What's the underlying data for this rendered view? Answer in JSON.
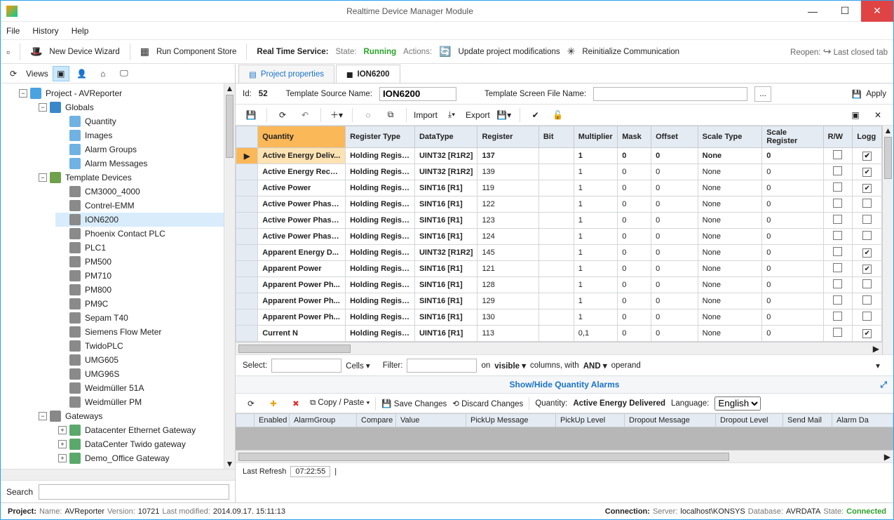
{
  "window": {
    "title": "Realtime Device Manager Module"
  },
  "menu": {
    "file": "File",
    "history": "History",
    "help": "Help"
  },
  "toolbar": {
    "newDevice": "New Device Wizard",
    "runStore": "Run Component Store",
    "rtsLabel": "Real Time Service:",
    "stateLabel": "State:",
    "stateValue": "Running",
    "actionsLabel": "Actions:",
    "updateMods": "Update project modifications",
    "reinit": "Reinitialize Communication",
    "reopenLabel": "Reopen:",
    "lastClosed": "Last closed tab"
  },
  "side": {
    "viewsLabel": "Views",
    "searchLabel": "Search"
  },
  "tree": {
    "root": "Project - AVReporter",
    "globals": "Globals",
    "globalsChildren": [
      "Quantity",
      "Images",
      "Alarm Groups",
      "Alarm Messages"
    ],
    "templates": "Template Devices",
    "templateDevices": [
      "CM3000_4000",
      "Contrel-EMM",
      "ION6200",
      "Phoenix Contact PLC",
      "PLC1",
      "PM500",
      "PM710",
      "PM800",
      "PM9C",
      "Sepam T40",
      "Siemens Flow Meter",
      "TwidoPLC",
      "UMG605",
      "UMG96S",
      "Weidmüller 51A",
      "Weidmüller PM"
    ],
    "gateways": "Gateways",
    "gatewayChildren": [
      "Datacenter Ethernet Gateway",
      "DataCenter Twido gateway",
      "Demo_Office Gateway"
    ]
  },
  "tabs": {
    "projectProps": "Project properties",
    "device": "ION6200"
  },
  "props": {
    "idLabel": "Id:",
    "idValue": "52",
    "tplLabel": "Template Source Name:",
    "tplValue": "ION6200",
    "screenLabel": "Template Screen File Name:",
    "screenValue": "",
    "ellipsis": "...",
    "apply": "Apply"
  },
  "gridToolbar": {
    "import": "Import",
    "export": "Export"
  },
  "columns": {
    "quantity": "Quantity",
    "registerType": "Register Type",
    "dataType": "DataType",
    "register": "Register",
    "bit": "Bit",
    "multiplier": "Multiplier",
    "mask": "Mask",
    "offset": "Offset",
    "scaleType": "Scale Type",
    "scaleRegister": "Scale Register",
    "rw": "R/W",
    "logg": "Logg"
  },
  "rows": [
    {
      "q": "Active Energy Deliv...",
      "rt": "Holding Registers",
      "dt": "UINT32 [R1R2]",
      "rg": "137",
      "bit": "",
      "mul": "1",
      "msk": "0",
      "off": "0",
      "st": "None",
      "sr": "0",
      "rw": false,
      "log": true,
      "sel": true
    },
    {
      "q": "Active Energy Recei...",
      "rt": "Holding Registers",
      "dt": "UINT32 [R1R2]",
      "rg": "139",
      "bit": "",
      "mul": "1",
      "msk": "0",
      "off": "0",
      "st": "None",
      "sr": "0",
      "rw": false,
      "log": true
    },
    {
      "q": "Active Power",
      "rt": "Holding Registers",
      "dt": "SINT16 [R1]",
      "rg": "119",
      "bit": "",
      "mul": "1",
      "msk": "0",
      "off": "0",
      "st": "None",
      "sr": "0",
      "rw": false,
      "log": true
    },
    {
      "q": "Active Power Phase A",
      "rt": "Holding Registers",
      "dt": "SINT16 [R1]",
      "rg": "122",
      "bit": "",
      "mul": "1",
      "msk": "0",
      "off": "0",
      "st": "None",
      "sr": "0",
      "rw": false,
      "log": false
    },
    {
      "q": "Active Power Phase B",
      "rt": "Holding Registers",
      "dt": "SINT16 [R1]",
      "rg": "123",
      "bit": "",
      "mul": "1",
      "msk": "0",
      "off": "0",
      "st": "None",
      "sr": "0",
      "rw": false,
      "log": false
    },
    {
      "q": "Active Power Phase C",
      "rt": "Holding Registers",
      "dt": "SINT16 [R1]",
      "rg": "124",
      "bit": "",
      "mul": "1",
      "msk": "0",
      "off": "0",
      "st": "None",
      "sr": "0",
      "rw": false,
      "log": false
    },
    {
      "q": "Apparent Energy D...",
      "rt": "Holding Registers",
      "dt": "UINT32 [R1R2]",
      "rg": "145",
      "bit": "",
      "mul": "1",
      "msk": "0",
      "off": "0",
      "st": "None",
      "sr": "0",
      "rw": false,
      "log": true
    },
    {
      "q": "Apparent Power",
      "rt": "Holding Registers",
      "dt": "SINT16 [R1]",
      "rg": "121",
      "bit": "",
      "mul": "1",
      "msk": "0",
      "off": "0",
      "st": "None",
      "sr": "0",
      "rw": false,
      "log": true
    },
    {
      "q": "Apparent Power Ph...",
      "rt": "Holding Registers",
      "dt": "SINT16 [R1]",
      "rg": "128",
      "bit": "",
      "mul": "1",
      "msk": "0",
      "off": "0",
      "st": "None",
      "sr": "0",
      "rw": false,
      "log": false
    },
    {
      "q": "Apparent Power Ph...",
      "rt": "Holding Registers",
      "dt": "SINT16 [R1]",
      "rg": "129",
      "bit": "",
      "mul": "1",
      "msk": "0",
      "off": "0",
      "st": "None",
      "sr": "0",
      "rw": false,
      "log": false
    },
    {
      "q": "Apparent Power Ph...",
      "rt": "Holding Registers",
      "dt": "SINT16 [R1]",
      "rg": "130",
      "bit": "",
      "mul": "1",
      "msk": "0",
      "off": "0",
      "st": "None",
      "sr": "0",
      "rw": false,
      "log": false
    },
    {
      "q": "Current N",
      "rt": "Holding Registers",
      "dt": "UINT16 [R1]",
      "rg": "113",
      "bit": "",
      "mul": "0,1",
      "msk": "0",
      "off": "0",
      "st": "None",
      "sr": "0",
      "rw": false,
      "log": true
    }
  ],
  "filter": {
    "select": "Select:",
    "cells": "Cells",
    "filterLabel": "Filter:",
    "on": "on",
    "visible": "visible",
    "colsWith": "columns, with",
    "and": "AND",
    "operand": "operand"
  },
  "alarms": {
    "header": "Show/Hide Quantity Alarms",
    "copyPaste": "Copy / Paste",
    "save": "Save Changes",
    "discard": "Discard Changes",
    "qtyLabel": "Quantity:",
    "qtyValue": "Active Energy Delivered",
    "langLabel": "Language:",
    "langValue": "English",
    "cols": {
      "enabled": "Enabled",
      "group": "AlarmGroup",
      "compare": "Compare",
      "value": "Value",
      "pickupMsg": "PickUp Message",
      "pickupLvl": "PickUp Level",
      "dropMsg": "Dropout Message",
      "dropLvl": "Dropout Level",
      "sendMail": "Send Mail",
      "alarmDate": "Alarm Da"
    }
  },
  "refresh": {
    "label": "Last Refresh",
    "value": "07:22:55"
  },
  "status": {
    "projectLabel": "Project:",
    "nameLabel": "Name:",
    "nameVal": "AVReporter",
    "verLabel": "Version:",
    "verVal": "10721",
    "modLabel": "Last modified:",
    "modVal": "2014.09.17. 15:11:13",
    "connLabel": "Connection:",
    "serverLabel": "Server:",
    "serverVal": "localhost\\KONSYS",
    "dbLabel": "Database:",
    "dbVal": "AVRDATA",
    "stateLabel": "State:",
    "stateVal": "Connected"
  }
}
